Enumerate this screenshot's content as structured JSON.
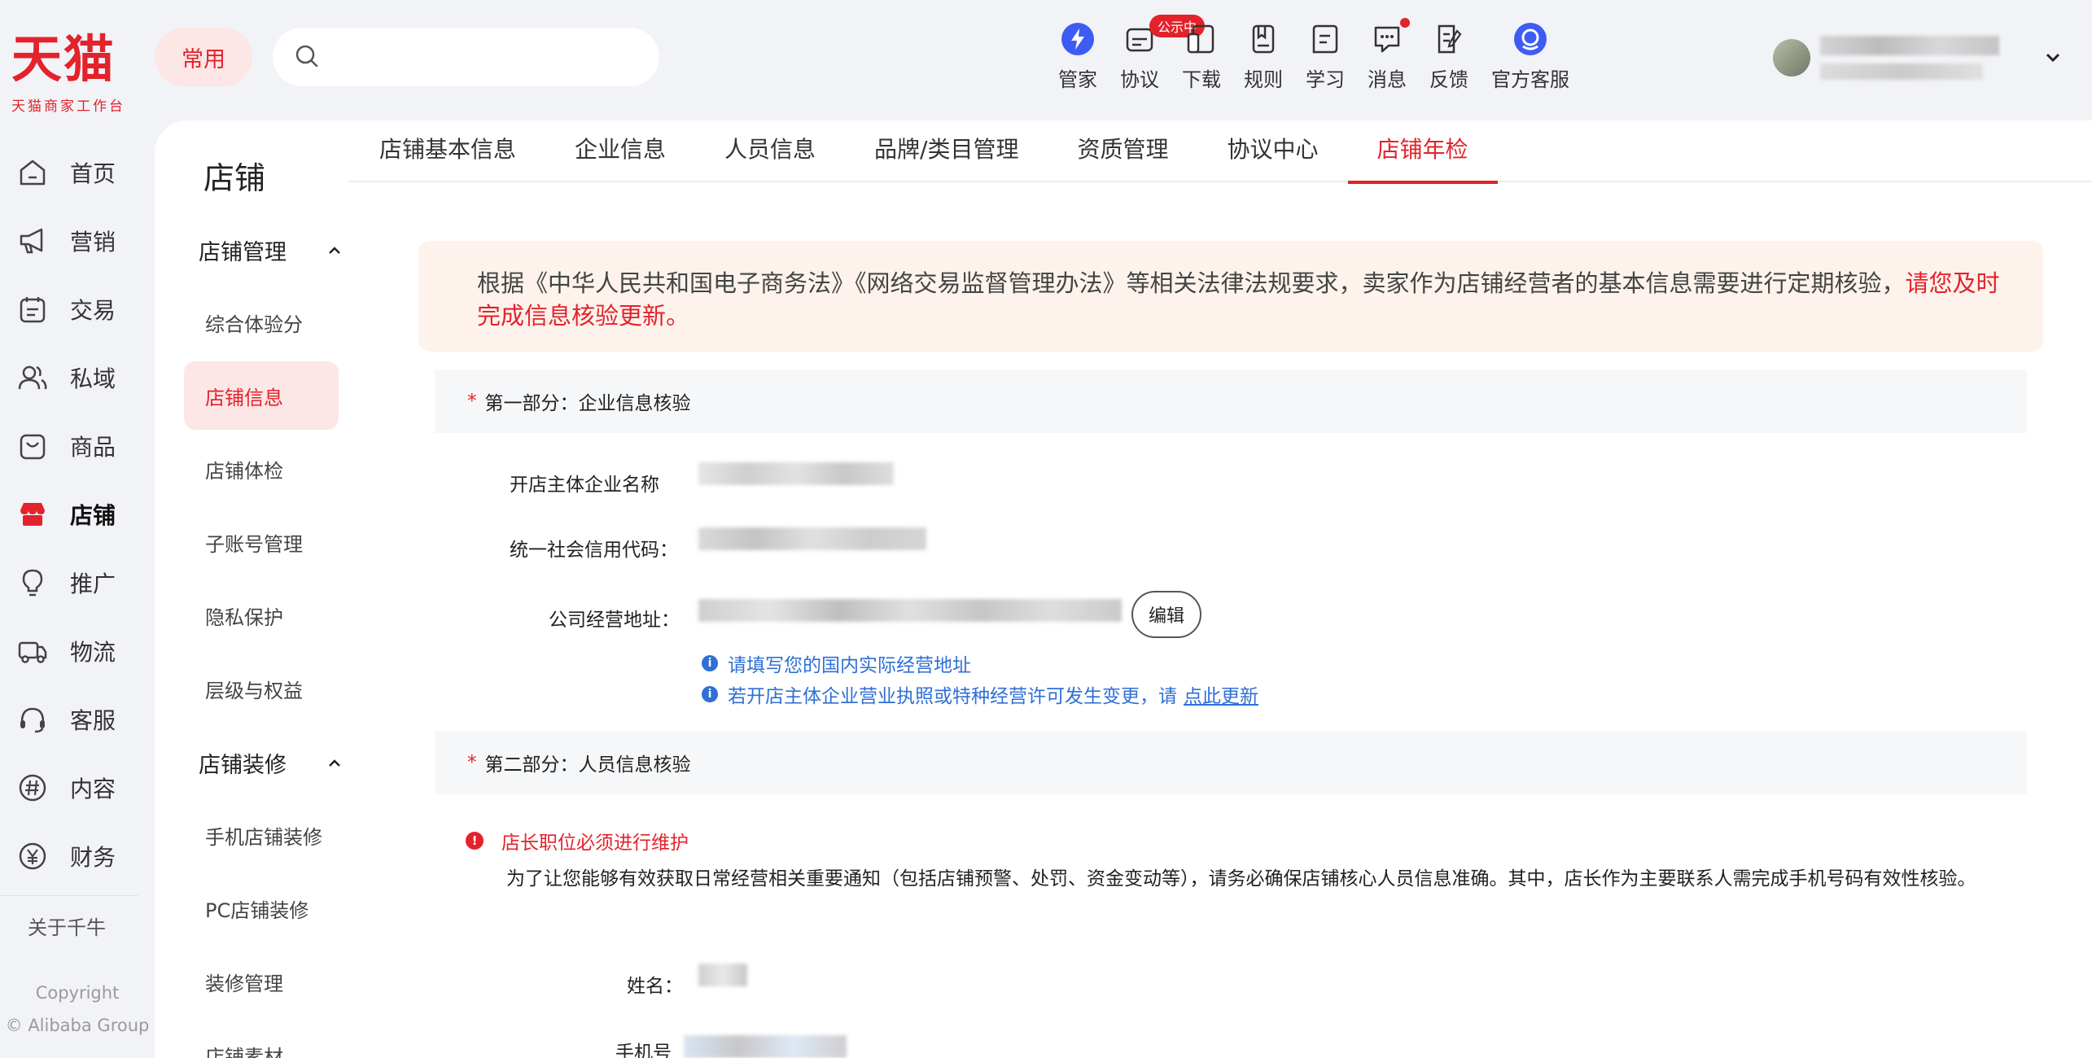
{
  "logo": {
    "main": "天猫",
    "sub": "天猫商家工作台"
  },
  "header": {
    "common_label": "常用",
    "search_placeholder": "",
    "tools": [
      {
        "label": "管家",
        "icon": "lightning-icon",
        "badge": ""
      },
      {
        "label": "协议",
        "icon": "agreement-icon",
        "badge": "公示中"
      },
      {
        "label": "下载",
        "icon": "download-device-icon",
        "badge": ""
      },
      {
        "label": "规则",
        "icon": "rulebook-icon",
        "badge": ""
      },
      {
        "label": "学习",
        "icon": "learn-icon",
        "badge": ""
      },
      {
        "label": "消息",
        "icon": "message-icon",
        "badge": "dot"
      },
      {
        "label": "反馈",
        "icon": "feedback-icon",
        "badge": ""
      },
      {
        "label": "官方客服",
        "icon": "customer-service-icon",
        "badge": ""
      }
    ]
  },
  "leftnav": {
    "items": [
      {
        "label": "首页",
        "icon": "home-icon"
      },
      {
        "label": "营销",
        "icon": "megaphone-icon"
      },
      {
        "label": "交易",
        "icon": "transaction-icon"
      },
      {
        "label": "私域",
        "icon": "private-domain-icon"
      },
      {
        "label": "商品",
        "icon": "goods-icon"
      },
      {
        "label": "店铺",
        "icon": "store-icon"
      },
      {
        "label": "推广",
        "icon": "promotion-icon"
      },
      {
        "label": "物流",
        "icon": "truck-icon"
      },
      {
        "label": "客服",
        "icon": "headset-icon"
      },
      {
        "label": "内容",
        "icon": "hashtag-icon"
      },
      {
        "label": "财务",
        "icon": "yuan-icon"
      }
    ],
    "active_index": 5,
    "about": "关于千牛",
    "copyright_line1": "Copyright",
    "copyright_line2": "© Alibaba Group"
  },
  "subnav": {
    "title": "店铺",
    "group1": "店铺管理",
    "group1_items": [
      "综合体验分",
      "店铺信息",
      "店铺体检",
      "子账号管理",
      "隐私保护",
      "层级与权益"
    ],
    "group2": "店铺装修",
    "group2_items": [
      "手机店铺装修",
      "PC店铺装修",
      "装修管理",
      "店铺素材"
    ],
    "active_item": "店铺信息"
  },
  "tabs": [
    "店铺基本信息",
    "企业信息",
    "人员信息",
    "品牌/类目管理",
    "资质管理",
    "协议中心",
    "店铺年检"
  ],
  "active_tab": "店铺年检",
  "notice": {
    "text": "根据《中华人民共和国电子商务法》《网络交易监督管理办法》等相关法律法规要求，卖家作为店铺经营者的基本信息需要进行定期核验，",
    "highlight": "请您及时完成信息核验更新。"
  },
  "section1": {
    "star": "*",
    "title": "第一部分：企业信息核验",
    "fields": {
      "company_name_label": "开店主体企业名称",
      "credit_code_label": "统一社会信用代码：",
      "address_label": "公司经营地址："
    },
    "edit_label": "编辑",
    "tip1": "请填写您的国内实际经营地址",
    "tip2": "若开店主体企业营业执照或特种经营许可发生变更，请",
    "tip2_link": "点此更新"
  },
  "section2": {
    "star": "*",
    "title": "第二部分：人员信息核验",
    "warning": "店长职位必须进行维护",
    "description": "为了让您能够有效获取日常经营相关重要通知（包括店铺预警、处罚、资金变动等），请务必确保店铺核心人员信息准确。其中，店长作为主要联系人需完成手机号码有效性核验。",
    "name_label": "姓名：",
    "phone_label": "手机号"
  },
  "colors": {
    "accent": "#e4222b",
    "link": "#2f6fd6",
    "notice_bg": "#fdf3ec"
  }
}
